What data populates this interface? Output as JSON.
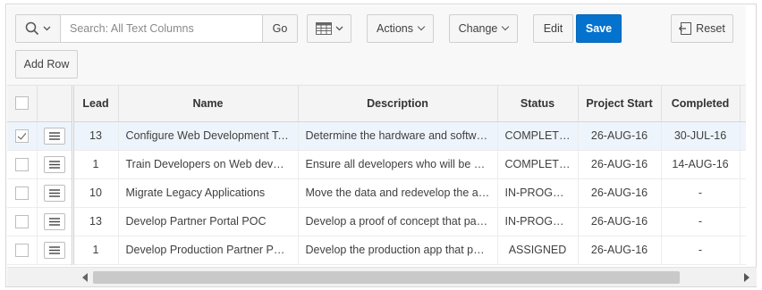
{
  "toolbar": {
    "search_placeholder": "Search: All Text Columns",
    "go_label": "Go",
    "actions_label": "Actions",
    "change_label": "Change",
    "edit_label": "Edit",
    "save_label": "Save",
    "reset_label": "Reset",
    "add_row_label": "Add Row"
  },
  "colors": {
    "primary": "#0572ce",
    "selected_row": "#eef4fc"
  },
  "grid": {
    "columns": [
      "Lead",
      "Name",
      "Description",
      "Status",
      "Project Start",
      "Completed"
    ],
    "rows": [
      {
        "selected": true,
        "lead": "13",
        "name": "Configure Web Development Tools",
        "description": "Determine the hardware and software required",
        "status": "COMPLETED",
        "start": "26-AUG-16",
        "completed": "30-JUL-16"
      },
      {
        "selected": false,
        "lead": "1",
        "name": "Train Developers on Web development",
        "description": "Ensure all developers who will be developing",
        "status": "COMPLETED",
        "start": "26-AUG-16",
        "completed": "14-AUG-16"
      },
      {
        "selected": false,
        "lead": "10",
        "name": "Migrate Legacy Applications",
        "description": "Move the data and redevelop the applications",
        "status": "IN-PROGRESS",
        "start": "26-AUG-16",
        "completed": "-"
      },
      {
        "selected": false,
        "lead": "13",
        "name": "Develop Partner Portal POC",
        "description": "Develop a proof of concept that partners",
        "status": "IN-PROGRESS",
        "start": "26-AUG-16",
        "completed": "-"
      },
      {
        "selected": false,
        "lead": "1",
        "name": "Develop Production Partner Portal",
        "description": "Develop the production app that partners",
        "status": "ASSIGNED",
        "start": "26-AUG-16",
        "completed": "-"
      }
    ]
  }
}
